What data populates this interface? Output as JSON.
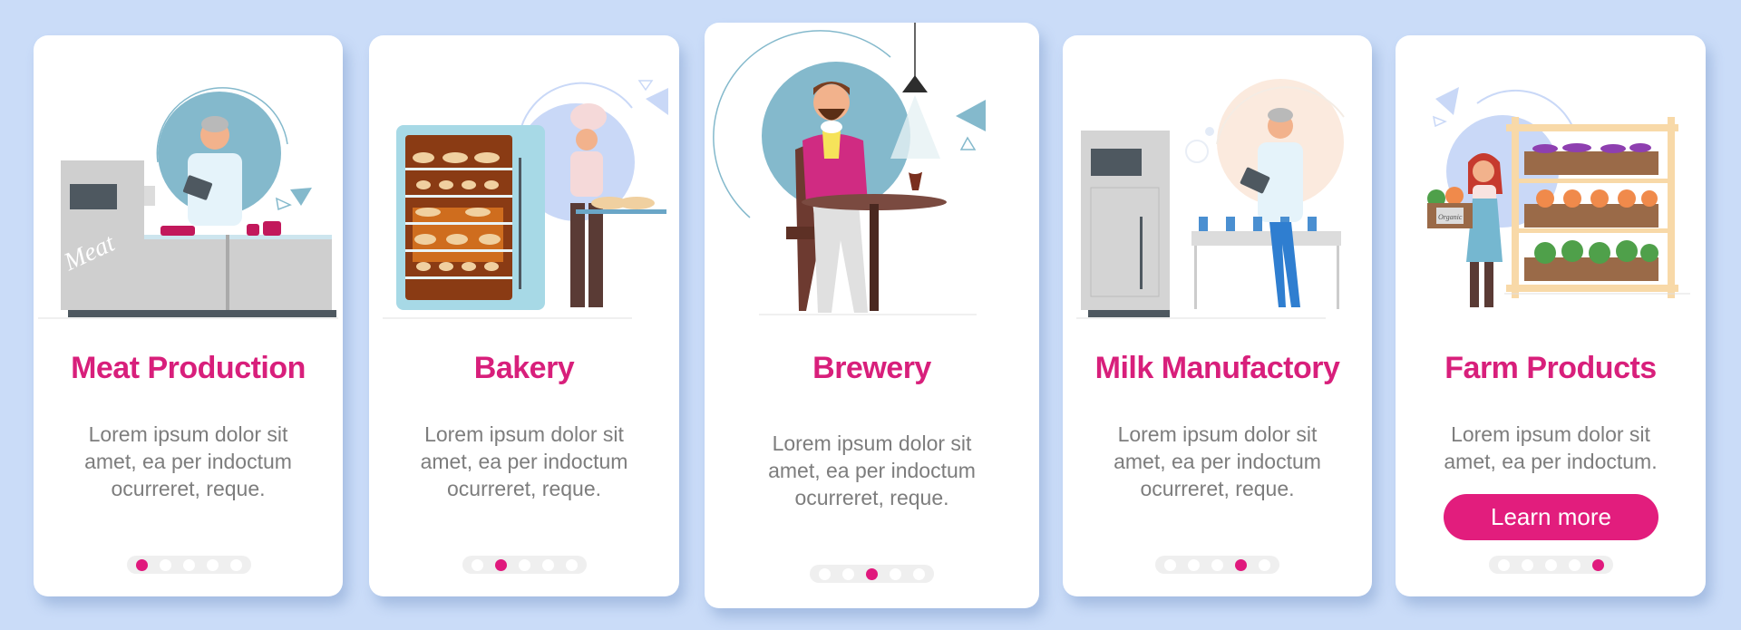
{
  "colors": {
    "background": "#cadcf8",
    "accent": "#e0197d",
    "title": "#d81f7b",
    "body_text": "#7d7d7d"
  },
  "cards": [
    {
      "title": "Meat Production",
      "body_lines": [
        "Lorem ipsum dolor sit",
        "amet, ea per indoctum",
        "ocurreret, reque."
      ],
      "illustration": "meat-production-illustration",
      "illustration_label": "Meat",
      "active_page": 1,
      "total_pages": 5
    },
    {
      "title": "Bakery",
      "body_lines": [
        "Lorem ipsum dolor sit",
        "amet, ea per indoctum",
        "ocurreret, reque."
      ],
      "illustration": "bakery-illustration",
      "active_page": 2,
      "total_pages": 5
    },
    {
      "title": "Brewery",
      "body_lines": [
        "Lorem ipsum dolor sit",
        "amet, ea per indoctum",
        "ocurreret, reque."
      ],
      "illustration": "brewery-illustration",
      "active_page": 3,
      "total_pages": 5
    },
    {
      "title": "Milk Manufactory",
      "body_lines": [
        "Lorem ipsum dolor sit",
        "amet, ea per indoctum",
        "ocurreret, reque."
      ],
      "illustration": "milk-manufactory-illustration",
      "active_page": 4,
      "total_pages": 5
    },
    {
      "title": "Farm Products",
      "body_lines": [
        "Lorem ipsum dolor sit",
        "amet, ea per indoctum."
      ],
      "illustration": "farm-products-illustration",
      "illustration_label": "Organic",
      "button_label": "Learn more",
      "active_page": 5,
      "total_pages": 5
    }
  ]
}
